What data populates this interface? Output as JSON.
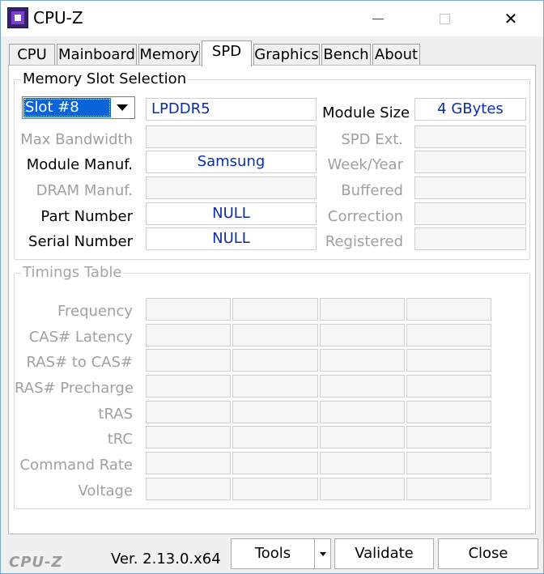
{
  "window": {
    "title": "CPU-Z",
    "minimize_glyph": "",
    "close_glyph": "✕"
  },
  "tabs": [
    {
      "label": "CPU"
    },
    {
      "label": "Mainboard"
    },
    {
      "label": "Memory"
    },
    {
      "label": "SPD",
      "active": true
    },
    {
      "label": "Graphics"
    },
    {
      "label": "Bench"
    },
    {
      "label": "About"
    }
  ],
  "slot_section": {
    "title": "Memory Slot Selection",
    "slot_selected": "Slot #8",
    "memory_type": "LPDDR5",
    "module_size_label": "Module Size",
    "module_size_value": "4 GBytes",
    "max_bandwidth_label": "Max Bandwidth",
    "max_bandwidth_value": "",
    "module_manuf_label": "Module Manuf.",
    "module_manuf_value": "Samsung",
    "dram_manuf_label": "DRAM Manuf.",
    "dram_manuf_value": "",
    "part_number_label": "Part Number",
    "part_number_value": "NULL",
    "serial_number_label": "Serial Number",
    "serial_number_value": "NULL",
    "spd_ext_label": "SPD Ext.",
    "spd_ext_value": "",
    "week_year_label": "Week/Year",
    "week_year_value": "",
    "buffered_label": "Buffered",
    "buffered_value": "",
    "correction_label": "Correction",
    "correction_value": "",
    "registered_label": "Registered",
    "registered_value": ""
  },
  "timings": {
    "title": "Timings Table",
    "rows": [
      {
        "label": "Frequency"
      },
      {
        "label": "CAS# Latency"
      },
      {
        "label": "RAS# to CAS#"
      },
      {
        "label": "RAS# Precharge"
      },
      {
        "label": "tRAS"
      },
      {
        "label": "tRC"
      },
      {
        "label": "Command Rate"
      },
      {
        "label": "Voltage"
      }
    ]
  },
  "footer": {
    "logo": "CPU-Z",
    "version": "Ver. 2.13.0.x64",
    "tools_label": "Tools",
    "validate_label": "Validate",
    "close_label": "Close"
  },
  "colors": {
    "value_text": "#0b2ea8",
    "selection": "#0a64d8",
    "disabled_text": "#a0a0a0"
  }
}
